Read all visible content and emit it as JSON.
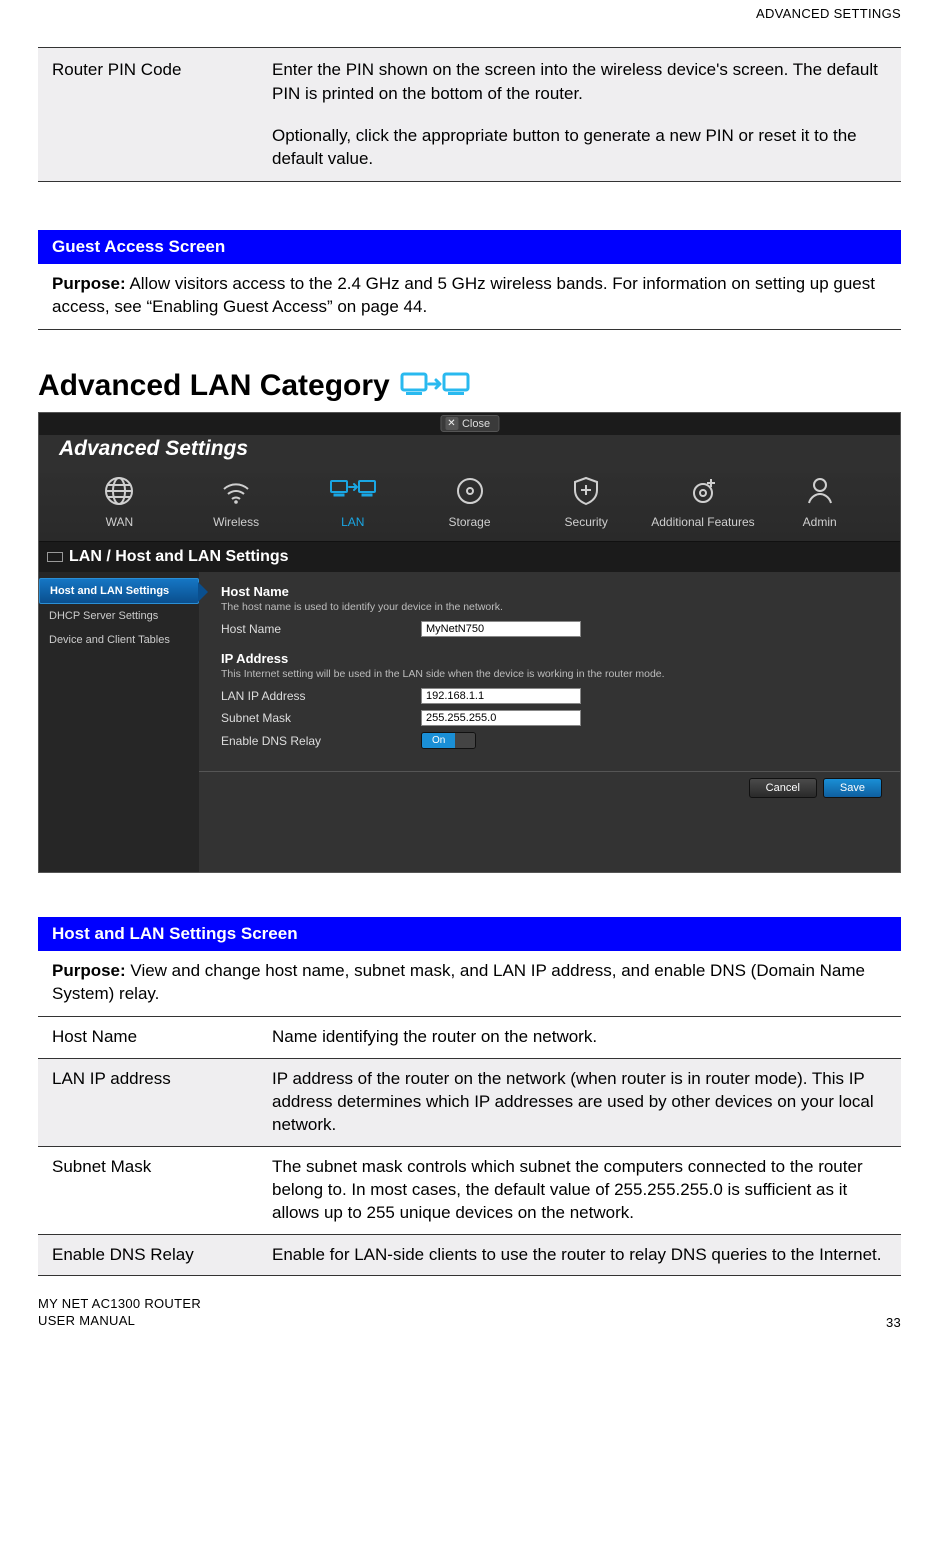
{
  "header_right": "ADVANCED SETTINGS",
  "top_table": {
    "label": "Router PIN Code",
    "p1": "Enter the PIN shown on the screen into the wireless device's screen. The default PIN is printed on the bottom of the router.",
    "p2": "Optionally, click the appropriate button to generate a new PIN or reset it to the default value."
  },
  "guest_banner": {
    "title": "Guest Access Screen",
    "purpose_label": "Purpose:",
    "purpose_text": " Allow visitors access to the 2.4 GHz and 5 GHz wireless bands. For information on setting up guest access, see “Enabling Guest Access” on page 44."
  },
  "section_heading": "Advanced LAN Category",
  "router_ui": {
    "close_label": "Close",
    "title": "Advanced Settings",
    "categories": [
      "WAN",
      "Wireless",
      "LAN",
      "Storage",
      "Security",
      "Additional Features",
      "Admin"
    ],
    "active_category_index": 2,
    "subheading": "LAN / Host and LAN Settings",
    "sidebar": [
      "Host and LAN Settings",
      "DHCP Server Settings",
      "Device and Client Tables"
    ],
    "sidebar_active_index": 0,
    "group1_title": "Host Name",
    "group1_hint": "The host name is used to identify your device in the network.",
    "row_hostname_label": "Host Name",
    "row_hostname_value": "MyNetN750",
    "group2_title": "IP Address",
    "group2_hint": "This Internet setting will be used in the LAN side when the device is working in the router mode.",
    "row_lanip_label": "LAN IP Address",
    "row_lanip_value": "192.168.1.1",
    "row_subnet_label": "Subnet Mask",
    "row_subnet_value": "255.255.255.0",
    "row_dns_label": "Enable DNS Relay",
    "toggle_on": "On",
    "toggle_off": "",
    "btn_cancel": "Cancel",
    "btn_save": "Save"
  },
  "host_banner": {
    "title": "Host and LAN Settings Screen",
    "purpose_label": "Purpose:",
    "purpose_text": " View and change host name, subnet mask, and LAN IP address, and enable DNS (Domain Name System) relay."
  },
  "desc_table": [
    {
      "k": "Host Name",
      "v": "Name identifying the router on the network."
    },
    {
      "k": "LAN IP address",
      "v": "IP address of the router on the network (when router is in router mode). This IP address determines which IP addresses are used by other devices on your local network."
    },
    {
      "k": "Subnet Mask",
      "v": "The subnet mask controls which subnet the computers connected to the router belong to. In most cases, the default value of 255.255.255.0 is sufficient as it allows up to 255 unique devices on the network."
    },
    {
      "k": "Enable DNS Relay",
      "v": "Enable for LAN-side clients to use the router to relay DNS queries to the Internet."
    }
  ],
  "footer": {
    "line1": "MY NET AC1300 ROUTER",
    "line2": "USER MANUAL",
    "page": "33"
  }
}
